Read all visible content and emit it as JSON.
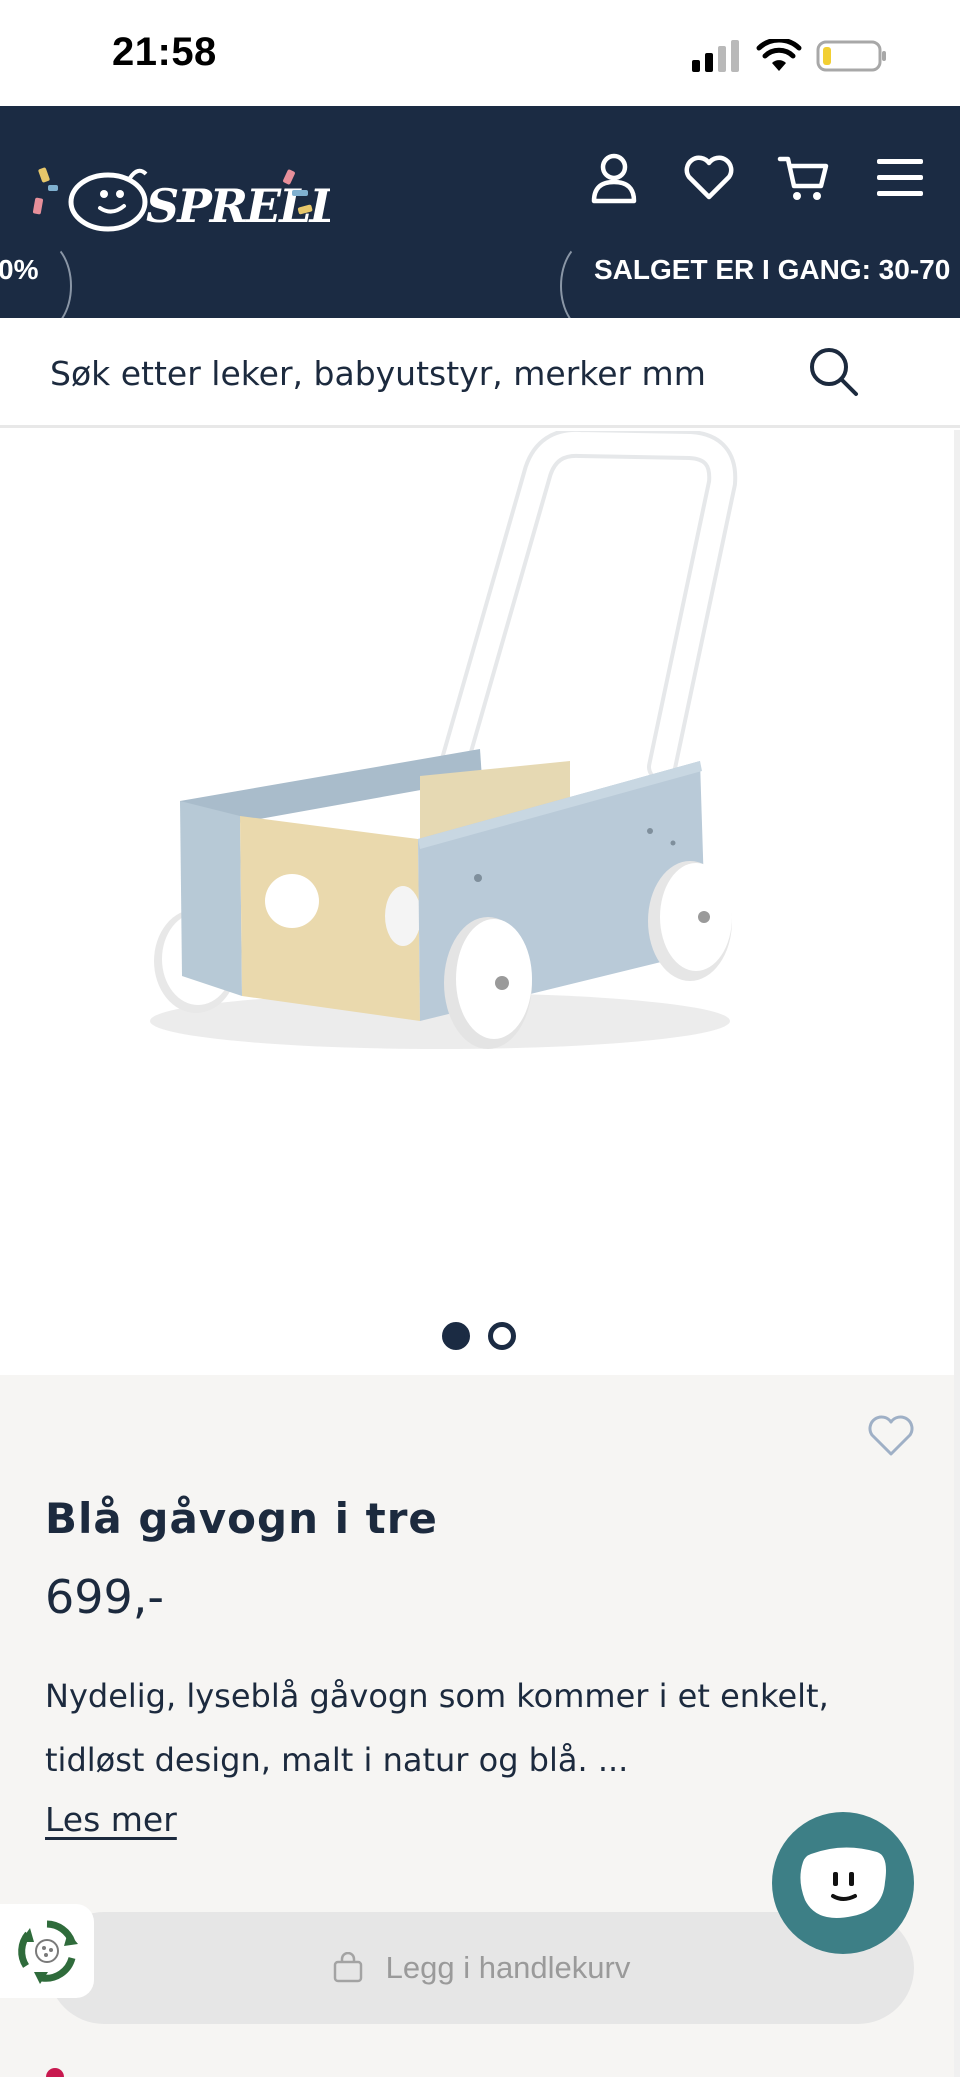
{
  "status_bar": {
    "time": "21:58"
  },
  "header": {
    "logo_text": "SPRELL",
    "icons": [
      "user-icon",
      "heart-icon",
      "cart-icon",
      "menu-icon"
    ],
    "ticker": {
      "left_fragment": "0%",
      "message": "SALGET ER I GANG: 30-70"
    }
  },
  "search": {
    "placeholder": "Søk etter leker, babyutstyr, merker mm"
  },
  "gallery": {
    "image_alt": "Blå gåvogn i tre",
    "slide_count": 2,
    "active_slide": 1
  },
  "product": {
    "title": "Blå gåvogn i tre",
    "price": "699,-",
    "description": "Nydelig, lyseblå gåvogn som kommer i et enkelt, tidløst design, malt i natur og blå. ...",
    "read_more": "Les mer",
    "add_to_cart": "Legg i handlekurv"
  },
  "colors": {
    "navy": "#1b2b43",
    "teal": "#3d7f86",
    "background_info": "#f6f5f3",
    "accent_pink": "#c8194f"
  }
}
